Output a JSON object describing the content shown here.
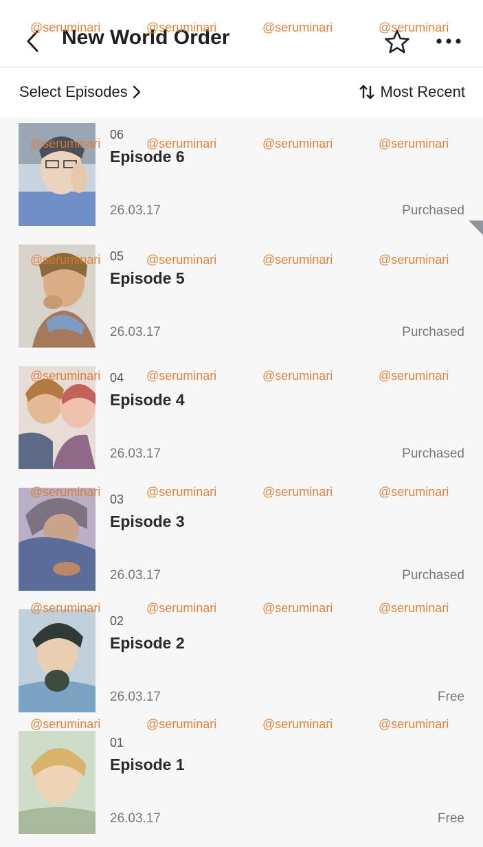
{
  "header": {
    "title": "New World Order",
    "back_icon": "chevron-left-icon",
    "favorite_icon": "star-outline-icon",
    "more_icon": "more-horizontal-icon"
  },
  "toolbar": {
    "select_label": "Select Episodes",
    "sort_label": "Most Recent",
    "sort_icon": "sort-arrows-icon"
  },
  "episodes": [
    {
      "number": "06",
      "title": "Episode 6",
      "date": "26.03.17",
      "status": "Purchased"
    },
    {
      "number": "05",
      "title": "Episode 5",
      "date": "26.03.17",
      "status": "Purchased"
    },
    {
      "number": "04",
      "title": "Episode 4",
      "date": "26.03.17",
      "status": "Purchased"
    },
    {
      "number": "03",
      "title": "Episode 3",
      "date": "26.03.17",
      "status": "Purchased"
    },
    {
      "number": "02",
      "title": "Episode 2",
      "date": "26.03.17",
      "status": "Free"
    },
    {
      "number": "01",
      "title": "Episode 1",
      "date": "26.03.17",
      "status": "Free"
    }
  ],
  "watermark": "@seruminari",
  "colors": {
    "watermark": "#e07a2c",
    "status_text": "#777777",
    "header_bg": "#ffffff",
    "list_bg": "#f7f7f7"
  }
}
